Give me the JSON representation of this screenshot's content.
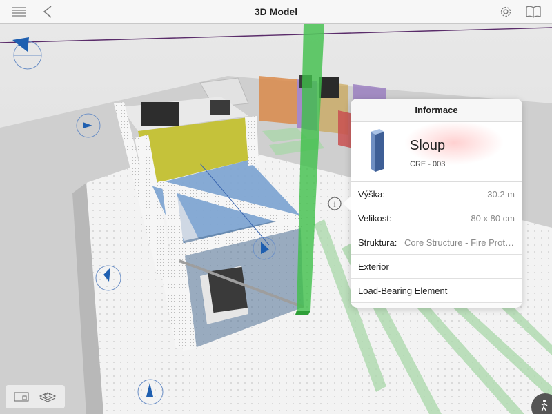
{
  "nav": {
    "title": "3D Model",
    "menu_icon": "hamburger-menu-icon",
    "back_icon": "back-arrow-icon",
    "settings_icon": "gear-icon",
    "book_icon": "book-icon"
  },
  "info": {
    "header": "Informace",
    "object_name": "Sloup",
    "object_code": "CRE - 003",
    "properties": [
      {
        "label": "Výška:",
        "value": "30.2 m"
      },
      {
        "label": "Velikost:",
        "value": "80 x 80 cm"
      },
      {
        "label": "Struktura:",
        "value": "Core Structure - Fire Protection"
      },
      {
        "label": "Exterior",
        "value": ""
      },
      {
        "label": "Load-Bearing Element",
        "value": ""
      }
    ]
  },
  "colors": {
    "accent_blue": "#1f5fb0",
    "selected_column": "#3fbf4a",
    "room_yellow": "#c5c23a",
    "room_blue": "#7aa2d0",
    "room_orange": "#d9894a",
    "room_purple": "#9a7fc0",
    "room_red": "#c95050"
  },
  "toolbar": {
    "layout_icon": "floor-plan-icon",
    "layers_icon": "layers-icon",
    "walk_icon": "walk-mode-icon"
  }
}
